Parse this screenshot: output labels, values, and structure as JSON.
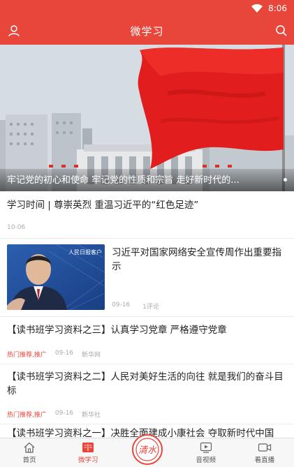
{
  "status_bar": {
    "time": "8:06"
  },
  "app_bar": {
    "title": "微学习"
  },
  "banner": {
    "caption": "牢记党的初心和使命 牢记党的性质和宗旨 走好新时代的..."
  },
  "news": [
    {
      "title": "学习时间 | 尊崇英烈 重温习近平的“红色足迹”",
      "date": "10-06"
    },
    {
      "title": "习近平对国家网络安全宣传周作出重要指示",
      "date": "09-16",
      "comments": "1评论",
      "thumb_text": "人民日报客户"
    },
    {
      "title": "【读书班学习资料之三】认真学习党章 严格遵守党章",
      "tag": "热门推荐,推广",
      "date": "09-16",
      "source": "新华网"
    },
    {
      "title": "【读书班学习资料之二】人民对美好生活的向往 就是我们的奋斗目标",
      "tag": "热门推荐,推广",
      "date": "09-16",
      "source": "新华社"
    },
    {
      "title": "【读书班学习资料之一】决胜全面建成小康社会 夺取新时代中国"
    }
  ],
  "tabbar": {
    "items": [
      {
        "label": "首页"
      },
      {
        "label": "微学习"
      },
      {
        "label": ""
      },
      {
        "label": "音视频"
      },
      {
        "label": "看直播"
      }
    ],
    "center_logo_text": "清水"
  },
  "colors": {
    "primary": "#e9463b"
  }
}
